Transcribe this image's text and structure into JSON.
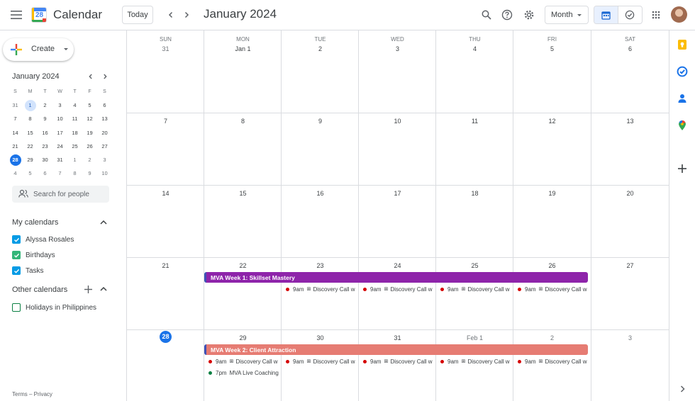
{
  "app": {
    "title": "Calendar",
    "logo_number": "28"
  },
  "toolbar": {
    "today_label": "Today",
    "month_title": "January 2024",
    "view_label": "Month"
  },
  "sidebar": {
    "create_label": "Create",
    "mini_calendar": {
      "title": "January 2024",
      "weekday_headers": [
        "S",
        "M",
        "T",
        "W",
        "T",
        "F",
        "S"
      ],
      "weeks": [
        [
          "31",
          "1",
          "2",
          "3",
          "4",
          "5",
          "6"
        ],
        [
          "7",
          "8",
          "9",
          "10",
          "11",
          "12",
          "13"
        ],
        [
          "14",
          "15",
          "16",
          "17",
          "18",
          "19",
          "20"
        ],
        [
          "21",
          "22",
          "23",
          "24",
          "25",
          "26",
          "27"
        ],
        [
          "28",
          "29",
          "30",
          "31",
          "1",
          "2",
          "3"
        ],
        [
          "4",
          "5",
          "6",
          "7",
          "8",
          "9",
          "10"
        ]
      ]
    },
    "search_people_placeholder": "Search for people",
    "my_calendars_title": "My calendars",
    "my_calendars": [
      {
        "label": "Alyssa Rosales",
        "color": "#039be5",
        "checked": true
      },
      {
        "label": "Birthdays",
        "color": "#33b679",
        "checked": true
      },
      {
        "label": "Tasks",
        "color": "#039be5",
        "checked": true
      }
    ],
    "other_calendars_title": "Other calendars",
    "other_calendars": [
      {
        "label": "Holidays in Philippines",
        "color": "#0b8043",
        "checked": false
      }
    ],
    "footer": "Terms – Privacy"
  },
  "grid": {
    "weekdays": [
      "SUN",
      "MON",
      "TUE",
      "WED",
      "THU",
      "FRI",
      "SAT"
    ],
    "weeks": [
      [
        "31",
        "Jan 1",
        "2",
        "3",
        "4",
        "5",
        "6"
      ],
      [
        "7",
        "8",
        "9",
        "10",
        "11",
        "12",
        "13"
      ],
      [
        "14",
        "15",
        "16",
        "17",
        "18",
        "19",
        "20"
      ],
      [
        "21",
        "22",
        "23",
        "24",
        "25",
        "26",
        "27"
      ],
      [
        "28",
        "29",
        "30",
        "31",
        "Feb 1",
        "2",
        "3"
      ]
    ],
    "banners": [
      {
        "label": "MVA Week 1: Skillset Mastery",
        "color": "#8e24aa"
      },
      {
        "label": "MVA Week 2: Client Attraction",
        "color": "#e67c73"
      }
    ],
    "events": {
      "discovery_time": "9am",
      "discovery_title": "Discovery Call w",
      "live_time": "7pm",
      "live_title": "MVA Live Coaching",
      "dot_red": "#d50000",
      "dot_green": "#0b8043"
    }
  },
  "colors": {
    "accent": "#1a73e8"
  }
}
